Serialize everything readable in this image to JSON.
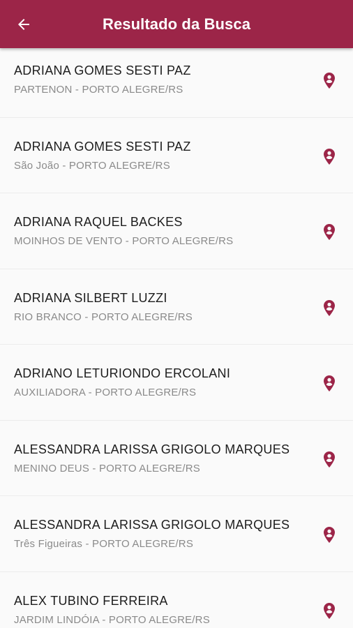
{
  "header": {
    "title": "Resultado da Busca",
    "back_icon": "arrow-left-icon"
  },
  "colors": {
    "primary": "#9c2548",
    "pin": "#9c2548",
    "name_text": "#1d1d1d",
    "sub_text": "#8a8a8a"
  },
  "results": [
    {
      "name": "ADRIANA GOMES SESTI PAZ",
      "location": "PARTENON - PORTO ALEGRE/RS"
    },
    {
      "name": "ADRIANA GOMES SESTI PAZ",
      "location": "São João - PORTO ALEGRE/RS"
    },
    {
      "name": "ADRIANA RAQUEL BACKES",
      "location": "MOINHOS DE VENTO - PORTO ALEGRE/RS"
    },
    {
      "name": "ADRIANA SILBERT LUZZI",
      "location": "RIO BRANCO - PORTO ALEGRE/RS"
    },
    {
      "name": "ADRIANO LETURIONDO ERCOLANI",
      "location": "AUXILIADORA - PORTO ALEGRE/RS"
    },
    {
      "name": "ALESSANDRA LARISSA GRIGOLO MARQUES",
      "location": "MENINO DEUS - PORTO ALEGRE/RS"
    },
    {
      "name": "ALESSANDRA LARISSA GRIGOLO MARQUES",
      "location": "Três Figueiras - PORTO ALEGRE/RS"
    },
    {
      "name": "ALEX TUBINO FERREIRA",
      "location": "JARDIM LINDÓIA - PORTO ALEGRE/RS"
    }
  ]
}
